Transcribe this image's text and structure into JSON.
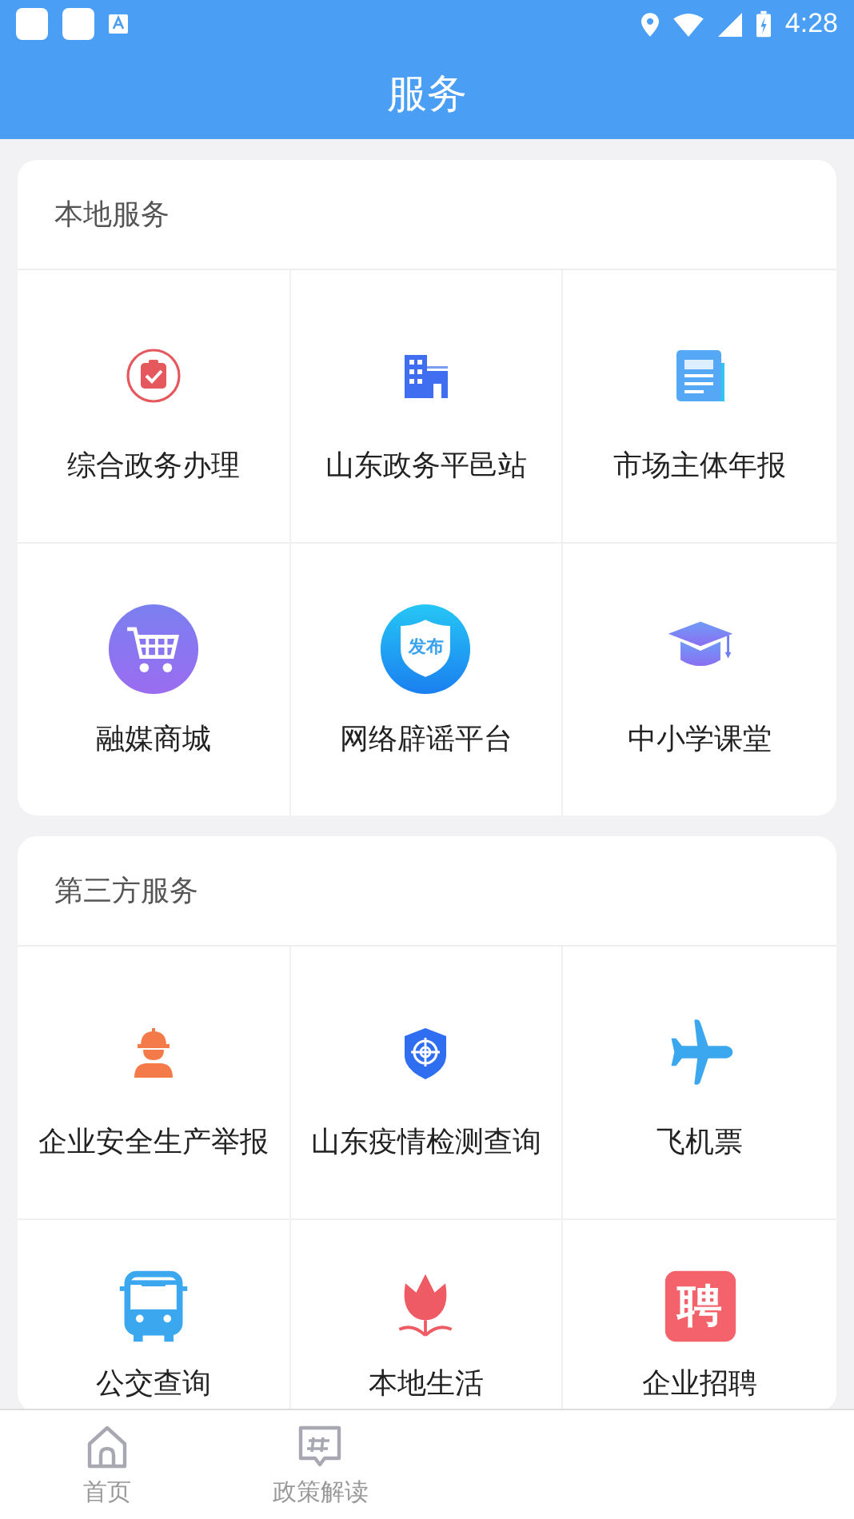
{
  "status_bar": {
    "time": "4:28"
  },
  "header": {
    "title": "服务"
  },
  "sections": [
    {
      "title": "本地服务",
      "items": [
        {
          "label": "综合政务办理"
        },
        {
          "label": "山东政务平邑站"
        },
        {
          "label": "市场主体年报"
        },
        {
          "label": "融媒商城"
        },
        {
          "label": "网络辟谣平台",
          "icon_text": "发布"
        },
        {
          "label": "中小学课堂"
        }
      ]
    },
    {
      "title": "第三方服务",
      "items": [
        {
          "label": "企业安全生产举报"
        },
        {
          "label": "山东疫情检测查询"
        },
        {
          "label": "飞机票"
        },
        {
          "label": "公交查询"
        },
        {
          "label": "本地生活"
        },
        {
          "label": "企业招聘",
          "icon_text": "聘"
        }
      ]
    }
  ],
  "bottom_nav": [
    {
      "label": "首页"
    },
    {
      "label": "政策解读"
    }
  ]
}
